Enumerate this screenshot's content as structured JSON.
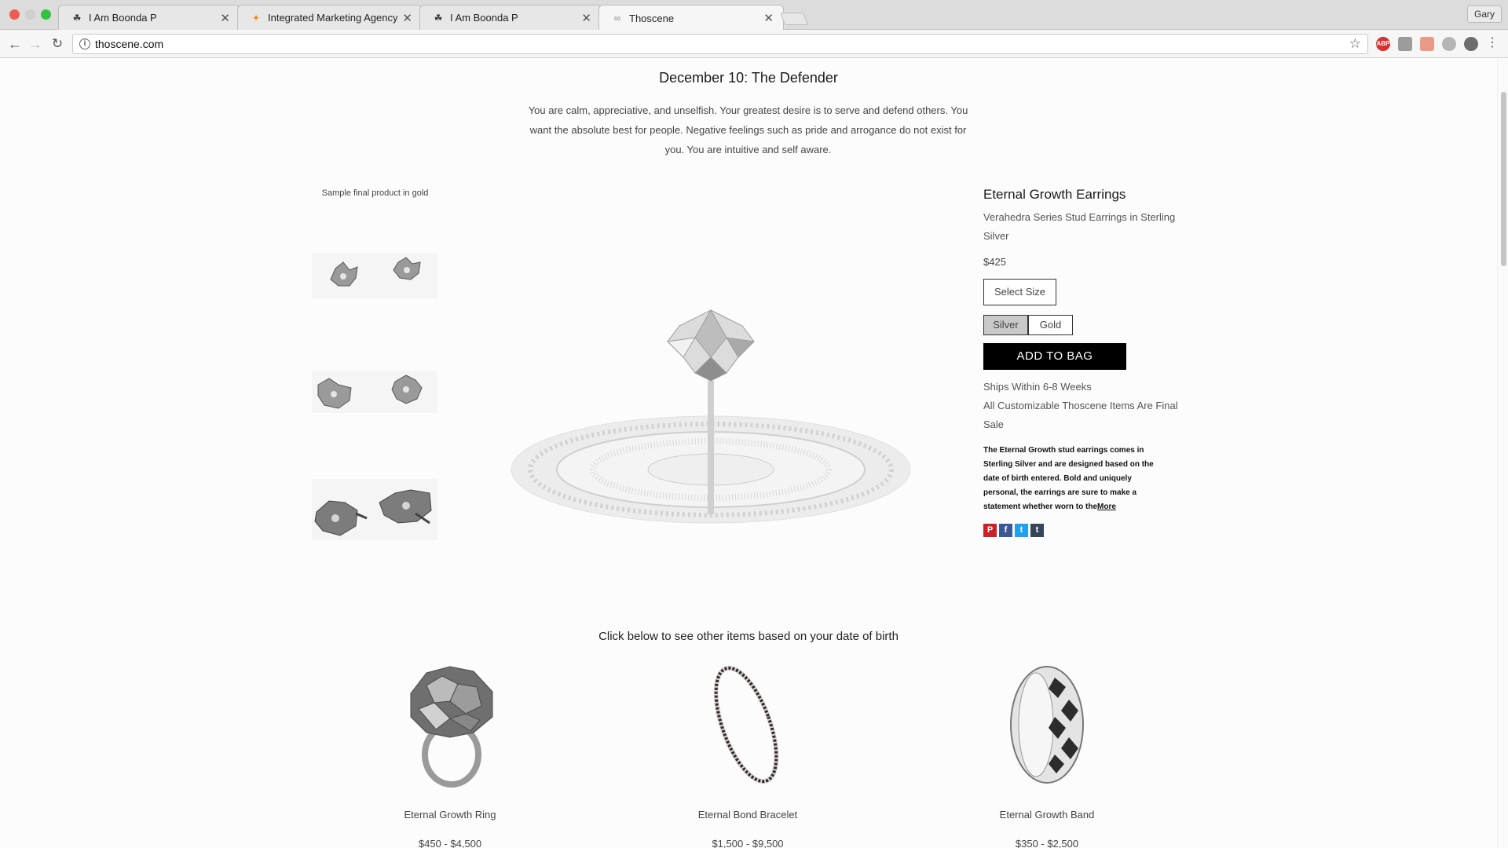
{
  "browser": {
    "tabs": [
      {
        "title": "I Am Boonda P",
        "icon": "boonda-icon",
        "active": false
      },
      {
        "title": "Integrated Marketing Agency",
        "icon": "agency-icon",
        "active": false
      },
      {
        "title": "I Am Boonda P",
        "icon": "boonda-icon",
        "active": false
      },
      {
        "title": "Thoscene",
        "icon": "link-icon",
        "active": true
      }
    ],
    "profile": "Gary",
    "url": "thoscene.com",
    "extensions": [
      {
        "name": "abp-icon",
        "label": "ABP",
        "color": "#d9302c"
      },
      {
        "name": "camera-icon",
        "label": "",
        "color": "#9c9c9c"
      },
      {
        "name": "pdf-icon",
        "label": "",
        "color": "#e89a86"
      },
      {
        "name": "circle-icon",
        "label": "",
        "color": "#b5b5b5"
      },
      {
        "name": "user-ext-icon",
        "label": "",
        "color": "#6d6d6d"
      }
    ]
  },
  "page": {
    "headline": "December 10: The Defender",
    "intro": "You are calm, appreciative, and unselfish. Your greatest desire is to serve and defend others. You want the absolute best for people. Negative feelings such as pride and arrogance do not exist for you. You are intuitive and self aware.",
    "thumb_caption": "Sample final product in gold"
  },
  "product": {
    "title": "Eternal Growth Earrings",
    "subtitle": "Verahedra Series Stud Earrings in Sterling Silver",
    "price": "$425",
    "size_label": "Select Size",
    "metals": [
      "Silver",
      "Gold"
    ],
    "selected_metal": "Silver",
    "add_to_bag": "ADD TO BAG",
    "ships": "Ships Within 6-8 Weeks",
    "final_sale": "All Customizable Thoscene Items Are Final Sale",
    "description": "The Eternal Growth stud earrings comes in Sterling Silver and are designed based on the date of birth entered. Bold and uniquely personal, the earrings are sure to make a statement whether worn to the",
    "more_label": "More",
    "social": [
      {
        "name": "pinterest-icon",
        "glyph": "P",
        "color": "#cb2027"
      },
      {
        "name": "facebook-icon",
        "glyph": "f",
        "color": "#3b5998"
      },
      {
        "name": "twitter-icon",
        "glyph": "t",
        "color": "#1da1f2"
      },
      {
        "name": "tumblr-icon",
        "glyph": "t",
        "color": "#35465c"
      }
    ]
  },
  "related": {
    "heading": "Click below to see other items based on your date of birth",
    "items": [
      {
        "name": "Eternal Growth Ring",
        "price": "$450 - $4,500"
      },
      {
        "name": "Eternal Bond Bracelet",
        "price": "$1,500 - $9,500"
      },
      {
        "name": "Eternal Growth Band",
        "price": "$350 - $2,500"
      }
    ]
  }
}
